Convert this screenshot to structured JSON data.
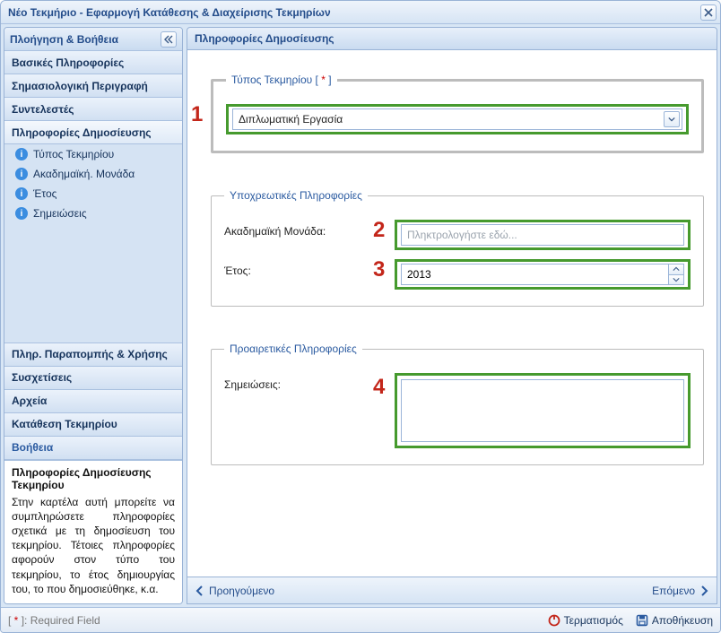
{
  "window": {
    "title": "Νέο Τεκμήριο - Εφαρμογή Κατάθεσης & Διαχείρισης Τεκμηρίων"
  },
  "sidebar": {
    "header": "Πλοήγηση & Βοήθεια",
    "items": [
      "Βασικές Πληροφορίες",
      "Σημασιολογική Περιγραφή",
      "Συντελεστές",
      "Πληροφορίες Δημοσίευσης",
      "Πληρ. Παραπομπής & Χρήσης",
      "Συσχετίσεις",
      "Αρχεία",
      "Κατάθεση Τεκμηρίου",
      "Βοήθεια"
    ],
    "tree": [
      "Τύπος Τεκμηρίου",
      "Ακαδημαϊκή. Μονάδα",
      "Έτος",
      "Σημειώσεις"
    ],
    "help": {
      "title": "Πληροφορίες Δημοσίευσης Τεκμηρίου",
      "body": "Στην καρτέλα αυτή μπορείτε να συμπληρώσετε πληροφορίες σχετικά με τη δημοσίευση του τεκμηρίου. Τέτοιες πληροφορίες αφορούν στον τύπο του τεκμηρίου, το έτος δημιουργίας του, το που δημοσιεύθηκε, κ.α."
    }
  },
  "main": {
    "header": "Πληροφορίες Δημοσίευσης",
    "fs_type": {
      "legend": "Τύπος Τεκμηρίου [",
      "star": " * ",
      "legend_end": "]",
      "value": "Διπλωματική Εργασία"
    },
    "fs_req": {
      "legend": "Υποχρεωτικές Πληροφορίες",
      "unit_label": "Ακαδημαϊκή Μονάδα:",
      "unit_placeholder": "Πληκτρολογήστε εδώ...",
      "year_label": "Έτος:",
      "year_value": "2013"
    },
    "fs_opt": {
      "legend": "Προαιρετικές Πληροφορίες",
      "notes_label": "Σημειώσεις:"
    },
    "badges": {
      "b1": "1",
      "b2": "2",
      "b3": "3",
      "b4": "4"
    }
  },
  "nav": {
    "prev": "Προηγούμενο",
    "next": "Επόμενο"
  },
  "footer": {
    "required_prefix": "[",
    "required_star": " * ",
    "required_suffix": "]: Required Field",
    "terminate": "Τερματισμός",
    "save": "Αποθήκευση"
  }
}
